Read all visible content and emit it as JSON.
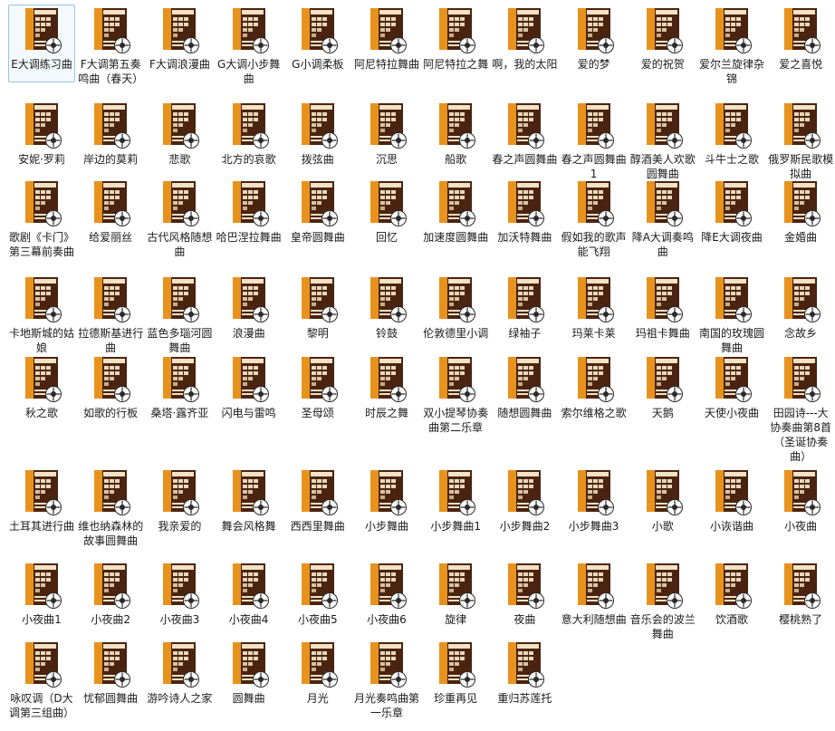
{
  "items": [
    {
      "label": "E大调练习曲"
    },
    {
      "label": "F大调第五奏鸣曲（春天）"
    },
    {
      "label": "F大调浪漫曲"
    },
    {
      "label": "G大调小步舞曲"
    },
    {
      "label": "G小调柔板"
    },
    {
      "label": "阿尼特拉舞曲"
    },
    {
      "label": "阿尼特拉之舞"
    },
    {
      "label": "啊，我的太阳"
    },
    {
      "label": "爱的梦"
    },
    {
      "label": "爱的祝贺"
    },
    {
      "label": "爱尔兰旋律杂锦"
    },
    {
      "label": "爱之喜悦"
    },
    {
      "label": "安妮·罗莉"
    },
    {
      "label": "岸边的莫莉"
    },
    {
      "label": "悲歌"
    },
    {
      "label": "北方的哀歌"
    },
    {
      "label": "拨弦曲"
    },
    {
      "label": "沉思"
    },
    {
      "label": "船歌"
    },
    {
      "label": "春之声圆舞曲"
    },
    {
      "label": "春之声圆舞曲1"
    },
    {
      "label": "醇酒美人欢歌圆舞曲"
    },
    {
      "label": "斗牛士之歌"
    },
    {
      "label": "俄罗斯民歌模拟曲"
    },
    {
      "label": "歌剧《卡门》第三幕前奏曲"
    },
    {
      "label": "给爱丽丝"
    },
    {
      "label": "古代风格随想曲"
    },
    {
      "label": "哈巴涅拉舞曲"
    },
    {
      "label": "皇帝圆舞曲"
    },
    {
      "label": "回忆"
    },
    {
      "label": "加速度圆舞曲"
    },
    {
      "label": "加沃特舞曲"
    },
    {
      "label": "假如我的歌声能飞翔"
    },
    {
      "label": "降A大调奏鸣曲"
    },
    {
      "label": "降E大调夜曲"
    },
    {
      "label": "金婚曲"
    },
    {
      "label": "卡地斯城的姑娘"
    },
    {
      "label": "拉德斯基进行曲"
    },
    {
      "label": "蓝色多瑙河圆舞曲"
    },
    {
      "label": "浪漫曲"
    },
    {
      "label": "黎明"
    },
    {
      "label": "铃鼓"
    },
    {
      "label": "伦敦德里小调"
    },
    {
      "label": "绿袖子"
    },
    {
      "label": "玛莱卡莱"
    },
    {
      "label": "玛祖卡舞曲"
    },
    {
      "label": "南国的玫瑰圆舞曲"
    },
    {
      "label": "念故乡"
    },
    {
      "label": "秋之歌"
    },
    {
      "label": "如歌的行板"
    },
    {
      "label": "桑塔·露齐亚"
    },
    {
      "label": "闪电与雷鸣"
    },
    {
      "label": "圣母颂"
    },
    {
      "label": "时辰之舞"
    },
    {
      "label": "双小提琴协奏曲第二乐章"
    },
    {
      "label": "随想圆舞曲"
    },
    {
      "label": "索尔维格之歌"
    },
    {
      "label": "天鹅"
    },
    {
      "label": "天使小夜曲"
    },
    {
      "label": "田园诗---大协奏曲第8首（圣诞协奏曲）"
    },
    {
      "label": "土耳其进行曲"
    },
    {
      "label": "维也纳森林的故事圆舞曲"
    },
    {
      "label": "我亲爱的"
    },
    {
      "label": "舞会风格舞"
    },
    {
      "label": "西西里舞曲"
    },
    {
      "label": "小步舞曲"
    },
    {
      "label": "小步舞曲1"
    },
    {
      "label": "小步舞曲2"
    },
    {
      "label": "小步舞曲3"
    },
    {
      "label": "小歌"
    },
    {
      "label": "小诙谐曲"
    },
    {
      "label": "小夜曲"
    },
    {
      "label": "小夜曲1"
    },
    {
      "label": "小夜曲2"
    },
    {
      "label": "小夜曲3"
    },
    {
      "label": "小夜曲4"
    },
    {
      "label": "小夜曲5"
    },
    {
      "label": "小夜曲6"
    },
    {
      "label": "旋律"
    },
    {
      "label": "夜曲"
    },
    {
      "label": "意大利随想曲"
    },
    {
      "label": "音乐会的波兰舞曲"
    },
    {
      "label": "饮酒歌"
    },
    {
      "label": "樱桃熟了"
    },
    {
      "label": "咏叹调（D大调第三组曲）"
    },
    {
      "label": "忧郁圆舞曲"
    },
    {
      "label": "游吟诗人之家"
    },
    {
      "label": "圆舞曲"
    },
    {
      "label": "月光"
    },
    {
      "label": "月光奏鸣曲第一乐章"
    },
    {
      "label": "珍重再见"
    },
    {
      "label": "重归苏莲托"
    }
  ],
  "selected_index": 0,
  "icon": {
    "name": "music-album-icon",
    "cover_dark": "#4a2410",
    "cover_orange": "#e8921e",
    "cover_cream": "#f3e2c4",
    "badge": "#ffffff"
  }
}
